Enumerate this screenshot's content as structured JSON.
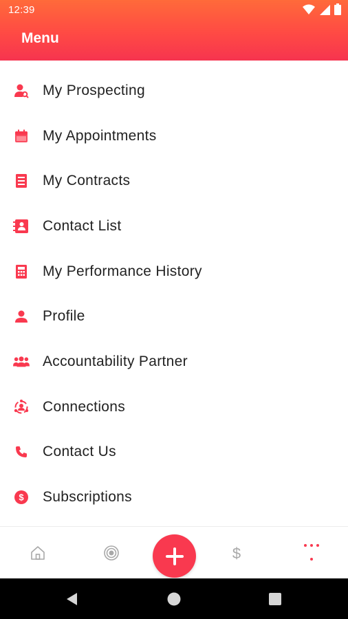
{
  "status_bar": {
    "time": "12:39",
    "icons": [
      "wifi-icon",
      "cellular-icon",
      "battery-icon"
    ]
  },
  "header": {
    "title": "Menu"
  },
  "menu": {
    "items": [
      {
        "label": "My Prospecting",
        "icon": "prospecting-icon"
      },
      {
        "label": "My Appointments",
        "icon": "calendar-icon"
      },
      {
        "label": "My Contracts",
        "icon": "document-icon"
      },
      {
        "label": "Contact List",
        "icon": "contact-book-icon"
      },
      {
        "label": "My Performance History",
        "icon": "calculator-icon"
      },
      {
        "label": "Profile",
        "icon": "person-icon"
      },
      {
        "label": "Accountability Partner",
        "icon": "group-icon"
      },
      {
        "label": "Connections",
        "icon": "network-icon"
      },
      {
        "label": "Contact Us",
        "icon": "phone-icon"
      },
      {
        "label": "Subscriptions",
        "icon": "dollar-circle-icon"
      }
    ]
  },
  "bottom_nav": {
    "items": [
      "home-icon",
      "target-icon",
      "add-icon",
      "dollar-icon",
      "more-dots-icon"
    ],
    "active": "more-dots-icon"
  },
  "system_nav": [
    "back-icon",
    "home-circle-icon",
    "recents-icon"
  ],
  "colors": {
    "accent": "#f9394f",
    "header_gradient_top": "#ff6a3a",
    "header_gradient_bottom": "#f6344f",
    "icon_gray": "#9e9e9e"
  }
}
